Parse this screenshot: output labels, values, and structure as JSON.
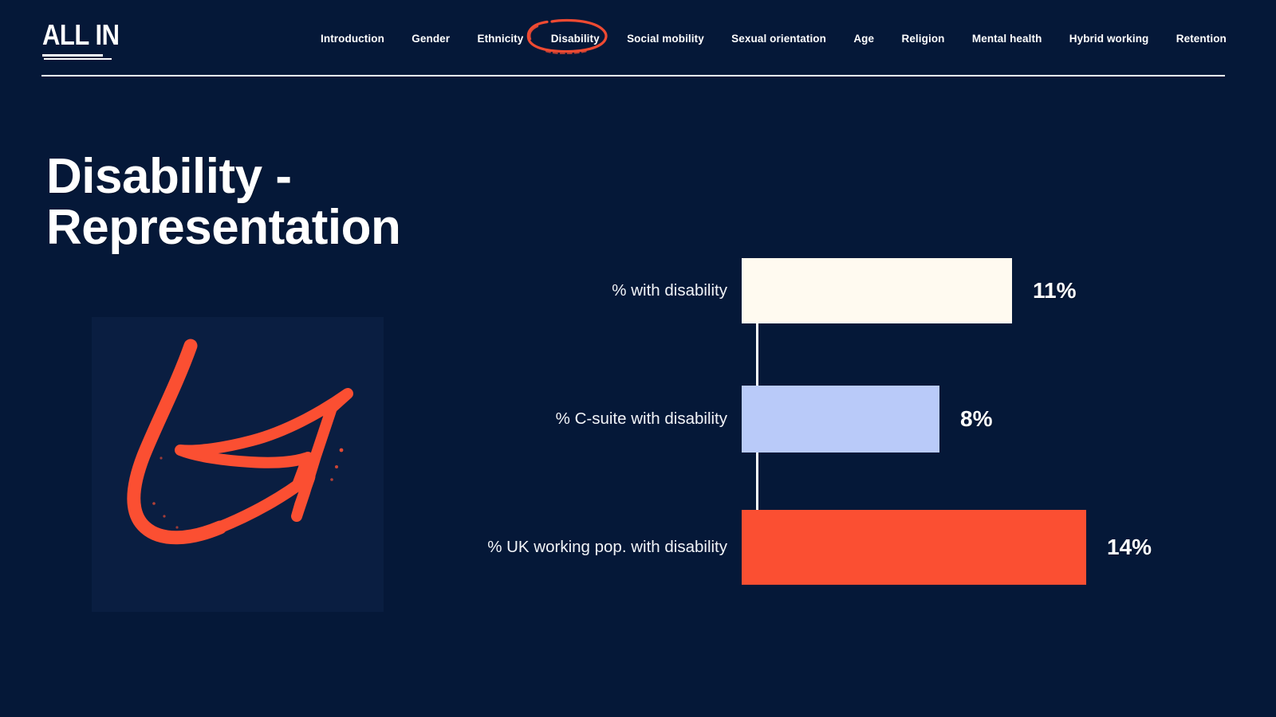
{
  "brand": {
    "logo_text": "ALL IN",
    "accent_color": "#fb4f32",
    "background_color": "#051838"
  },
  "header": {
    "nav_items": [
      {
        "label": "Introduction",
        "active": false
      },
      {
        "label": "Gender",
        "active": false
      },
      {
        "label": "Ethnicity",
        "active": false
      },
      {
        "label": "Disability",
        "active": true
      },
      {
        "label": "Social mobility",
        "active": false
      },
      {
        "label": "Sexual orientation",
        "active": false
      },
      {
        "label": "Age",
        "active": false
      },
      {
        "label": "Religion",
        "active": false
      },
      {
        "label": "Mental health",
        "active": false
      },
      {
        "label": "Hybrid working",
        "active": false
      },
      {
        "label": "Retention",
        "active": false
      }
    ]
  },
  "page": {
    "title": "Disability -\nRepresentation"
  },
  "graphic": {
    "icon": "hand-drawn-curved-arrow-icon"
  },
  "chart_data": {
    "type": "bar",
    "orientation": "horizontal",
    "title": "Disability - Representation",
    "xlabel": "",
    "ylabel": "",
    "grid": false,
    "legend": false,
    "xlim": [
      0,
      20
    ],
    "categories": [
      "% with disability",
      "% C-suite with disability",
      "% UK working pop. with disability"
    ],
    "values": [
      11,
      8,
      14
    ],
    "value_labels": [
      "11%",
      "8%",
      "14%"
    ],
    "colors": [
      "#fffaf0",
      "#b9caf9",
      "#fb4f32"
    ]
  }
}
